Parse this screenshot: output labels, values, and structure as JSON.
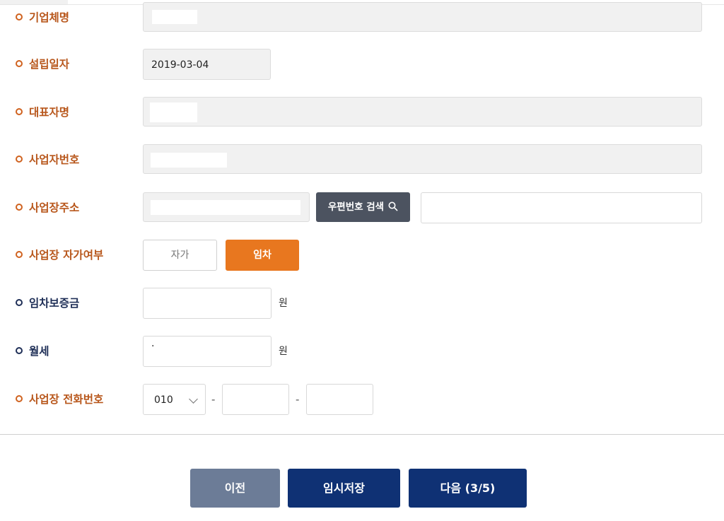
{
  "form": {
    "company_name": {
      "label": "기업체명",
      "value": ""
    },
    "established_date": {
      "label": "설립일자",
      "value": "2019-03-04"
    },
    "ceo_name": {
      "label": "대표자명",
      "value": ""
    },
    "business_number": {
      "label": "사업자번호",
      "value": ""
    },
    "business_address": {
      "label": "사업장주소",
      "address_value": "",
      "search_button": "우편번호 검색",
      "detail_value": ""
    },
    "ownership": {
      "label": "사업장 자가여부",
      "options": [
        "자가",
        "임차"
      ],
      "selected": "임차"
    },
    "lease_deposit": {
      "label": "임차보증금",
      "value": "",
      "unit": "원"
    },
    "monthly_rent": {
      "label": "월세",
      "value": "·",
      "unit": "원"
    },
    "phone": {
      "label": "사업장 전화번호",
      "prefix": "010",
      "middle": "",
      "last": "",
      "separator": "-"
    }
  },
  "footer": {
    "prev": "이전",
    "save": "임시저장",
    "next": "다음 (3/5)"
  },
  "colors": {
    "label_orange": "#b8571c",
    "label_navy": "#1f2f57",
    "accent_orange": "#e8771f",
    "navy_button": "#0f3174",
    "gray_button": "#6c7c97",
    "search_button": "#4c5360"
  }
}
